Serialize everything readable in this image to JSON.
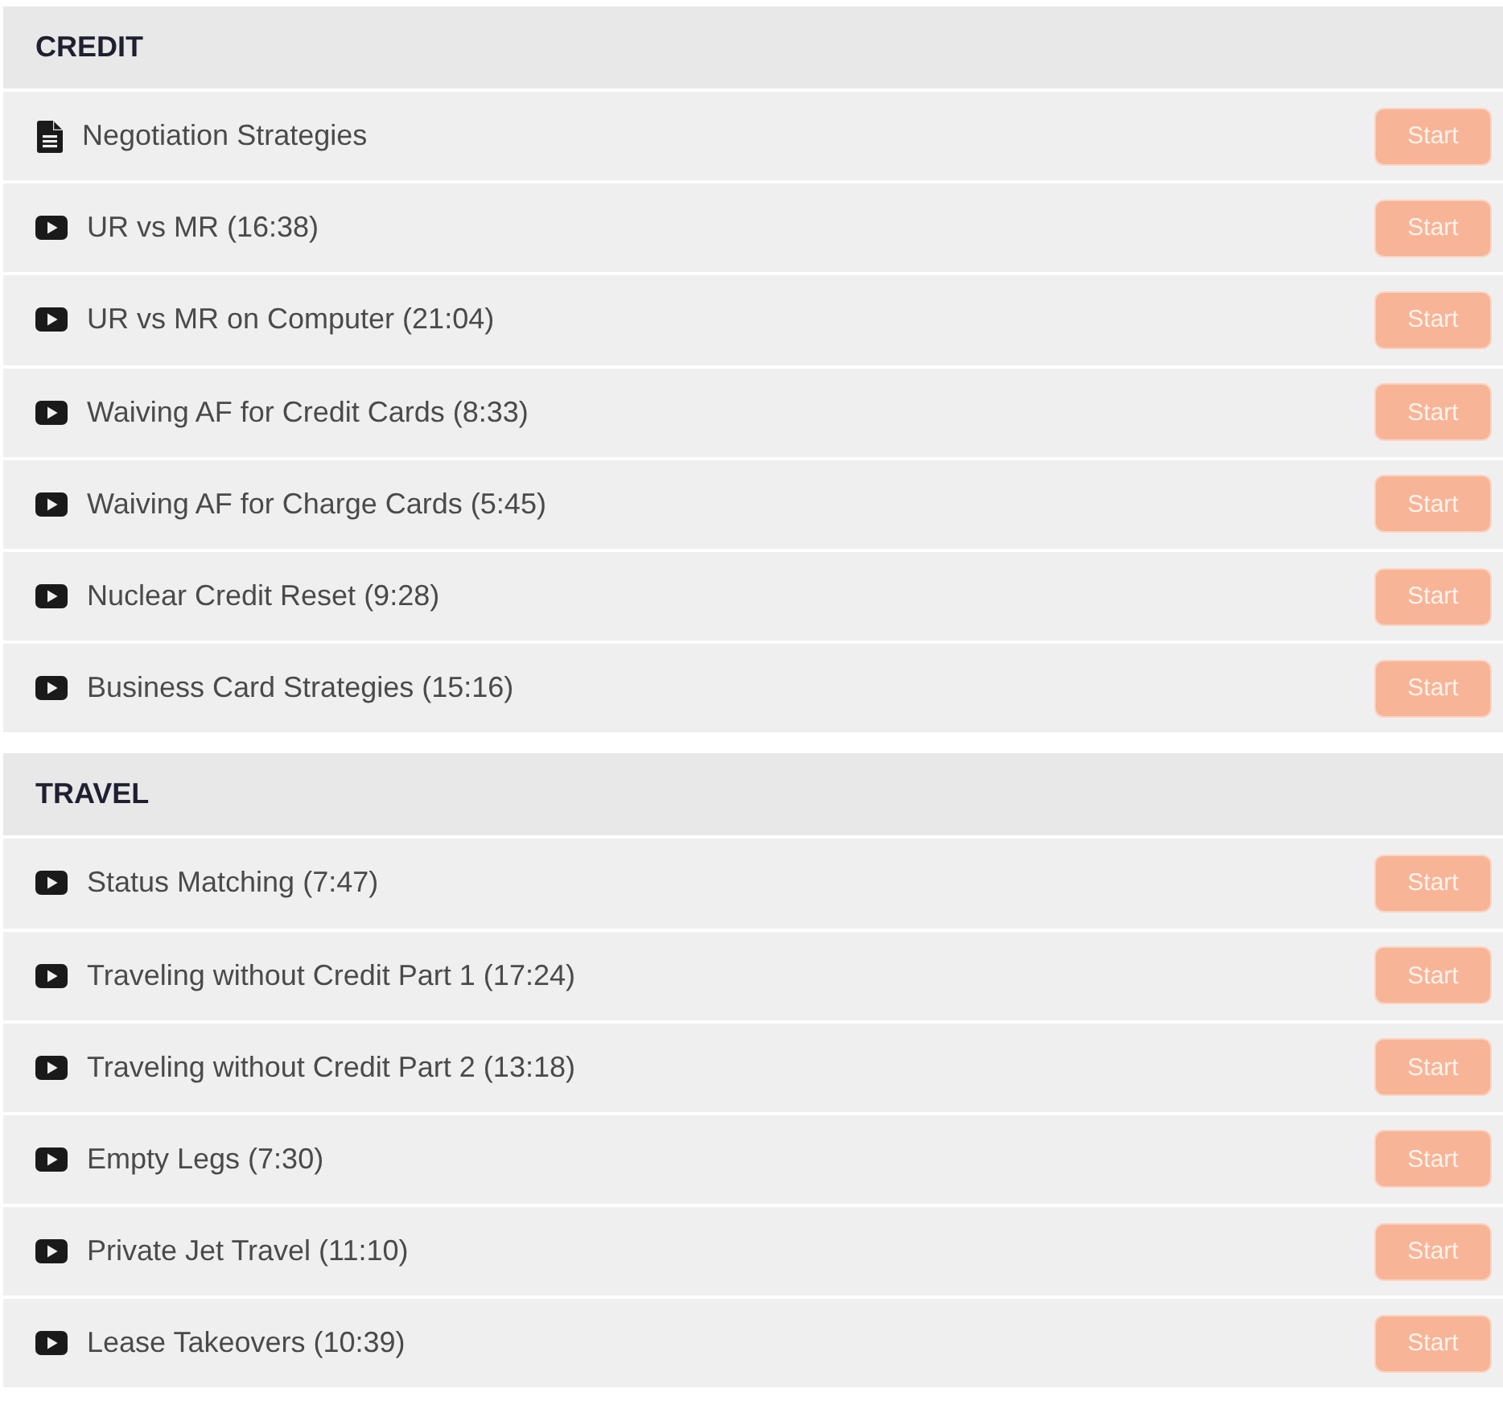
{
  "sections": [
    {
      "title": "CREDIT",
      "lessons": [
        {
          "kind": "document",
          "title": "Negotiation Strategies",
          "button": "Start"
        },
        {
          "kind": "video",
          "title": "UR vs MR (16:38)",
          "button": "Start"
        },
        {
          "kind": "video",
          "title": "UR vs MR on Computer (21:04)",
          "button": "Start"
        },
        {
          "kind": "video",
          "title": "Waiving AF for Credit Cards (8:33)",
          "button": "Start"
        },
        {
          "kind": "video",
          "title": "Waiving AF for Charge Cards (5:45)",
          "button": "Start"
        },
        {
          "kind": "video",
          "title": "Nuclear Credit Reset (9:28)",
          "button": "Start"
        },
        {
          "kind": "video",
          "title": "Business Card Strategies (15:16)",
          "button": "Start"
        }
      ]
    },
    {
      "title": "TRAVEL",
      "lessons": [
        {
          "kind": "video",
          "title": "Status Matching (7:47)",
          "button": "Start"
        },
        {
          "kind": "video",
          "title": "Traveling without Credit Part 1 (17:24)",
          "button": "Start"
        },
        {
          "kind": "video",
          "title": "Traveling without Credit Part 2 (13:18)",
          "button": "Start"
        },
        {
          "kind": "video",
          "title": "Empty Legs (7:30)",
          "button": "Start"
        },
        {
          "kind": "video",
          "title": "Private Jet Travel (11:10)",
          "button": "Start"
        },
        {
          "kind": "video",
          "title": "Lease Takeovers (10:39)",
          "button": "Start"
        }
      ]
    }
  ]
}
